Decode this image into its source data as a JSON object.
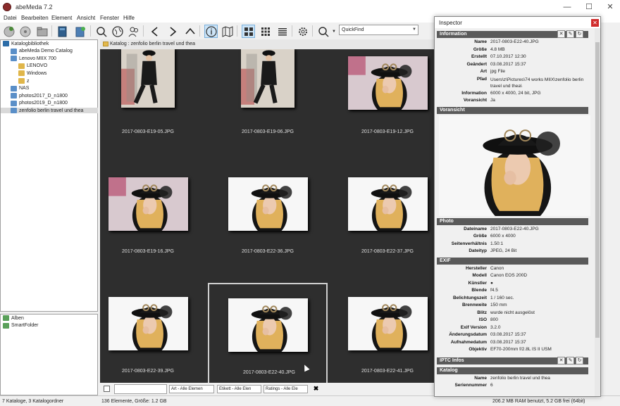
{
  "window": {
    "title": "abeMeda 7.2"
  },
  "menu": [
    "Datei",
    "Bearbeiten",
    "Element",
    "Ansicht",
    "Fenster",
    "Hilfe"
  ],
  "toolbar": {
    "quickfind_value": "QuickFind"
  },
  "catalog": {
    "tree": [
      {
        "label": "Katalogbibliothek",
        "level": 0,
        "icon": "library-icon"
      },
      {
        "label": "abeMeda Demo Catalog",
        "level": 1,
        "icon": "catalog-icon"
      },
      {
        "label": "Lenovo MIIX 700",
        "level": 1,
        "icon": "catalog-icon"
      },
      {
        "label": "LENOVO",
        "level": 2,
        "icon": "folder-icon"
      },
      {
        "label": "Windows",
        "level": 2,
        "icon": "folder-icon"
      },
      {
        "label": "z",
        "level": 2,
        "icon": "folder-icon"
      },
      {
        "label": "NAS",
        "level": 1,
        "icon": "catalog-icon"
      },
      {
        "label": "photos2017_D_n1800",
        "level": 1,
        "icon": "catalog-icon"
      },
      {
        "label": "photos2019_D_n1800",
        "level": 1,
        "icon": "catalog-icon"
      },
      {
        "label": "zenfolio berlin travel und thea",
        "level": 1,
        "icon": "catalog-icon",
        "selected": true
      }
    ],
    "albums": [
      {
        "label": "Alben",
        "icon": "album-icon"
      },
      {
        "label": "SmartFolder",
        "icon": "smartfolder-icon"
      }
    ]
  },
  "breadcrumb": "Katalog : zenfolio berlin travel und thea",
  "thumbnails": [
    {
      "name": "2017-0803-E19-05.JPG",
      "orient": "portrait",
      "style": "full"
    },
    {
      "name": "2017-0803-E19-06.JPG",
      "orient": "portrait",
      "style": "full"
    },
    {
      "name": "2017-0803-E19-12.JPG",
      "orient": "landscape",
      "style": "portrait-face"
    },
    {
      "name": "2017-0803-E19-16.JPG",
      "orient": "landscape",
      "style": "portrait-face"
    },
    {
      "name": "2017-0803-E22-36.JPG",
      "orient": "landscape",
      "style": "white"
    },
    {
      "name": "2017-0803-E22-37.JPG",
      "orient": "landscape",
      "style": "white"
    },
    {
      "name": "2017-0803-E22-39.JPG",
      "orient": "landscape",
      "style": "white"
    },
    {
      "name": "2017-0803-E22-40.JPG",
      "orient": "landscape",
      "style": "white",
      "selected": true
    },
    {
      "name": "2017-0803-E22-41.JPG",
      "orient": "landscape",
      "style": "white"
    }
  ],
  "filterbar": {
    "art": "Art - Alle Elemen",
    "etikett": "Etikett - Alle Elen",
    "ratings": "Ratings - Alle Ele"
  },
  "status": {
    "catalogs": "7 Kataloge, 3 Katalogordner",
    "elements": "136 Elemente, Größe: 1.2 GB",
    "ram": "206.2 MB RAM benutzt, 5.2 GB frei (64bit)"
  },
  "inspector": {
    "title": "Inspector",
    "information": {
      "header": "Information",
      "rows": [
        [
          "Name",
          "2017-0803-E22-40.JPG"
        ],
        [
          "Größe",
          "4.8 MB"
        ],
        [
          "Erstellt",
          "07.10.2017 12:30"
        ],
        [
          "Geändert",
          "03.08.2017 15:37"
        ],
        [
          "Art",
          "jpg File"
        ],
        [
          "Pfad",
          "Users\\z\\Pictures\\74 works MIIX\\zenfolio berlin travel und thea\\"
        ],
        [
          "Information",
          "6000 x 4000, 24 bit, JPG"
        ],
        [
          "Voransicht",
          "Ja"
        ]
      ]
    },
    "preview_header": "Voransicht",
    "photo": {
      "header": "Photo",
      "rows": [
        [
          "Dateiname",
          "2017-0803-E22-40.JPG"
        ],
        [
          "Größe",
          "6000 x 4000"
        ],
        [
          "Seitenverhältnis",
          "1.50:1"
        ],
        [
          "Dateityp",
          "JPEG, 24 Bit"
        ]
      ]
    },
    "exif": {
      "header": "EXIF",
      "rows": [
        [
          "Hersteller",
          "Canon"
        ],
        [
          "Modell",
          "Canon EOS 200D"
        ],
        [
          "Künstler",
          "●"
        ],
        [
          "Blende",
          "f4.5"
        ],
        [
          "Belichtungszeit",
          "1 / 160 sec."
        ],
        [
          "Brennweite",
          "150 mm"
        ],
        [
          "Blitz",
          "wurde nicht ausgelöst"
        ],
        [
          "ISO",
          "800"
        ],
        [
          "Exif Version",
          "3.2.0"
        ],
        [
          "Änderungsdatum",
          "03.08.2017 15:37"
        ],
        [
          "Aufnahmedatum",
          "03.08.2017 15:37"
        ],
        [
          "Objektiv",
          "EF70-200mm f/2.8L IS II USM"
        ]
      ]
    },
    "iptc": {
      "header": "IPTC Infos"
    },
    "katalog": {
      "header": "Katalog",
      "rows": [
        [
          "Name",
          "zenfolio berlin travel und thea"
        ],
        [
          "Seriennummer",
          "6"
        ]
      ]
    }
  }
}
